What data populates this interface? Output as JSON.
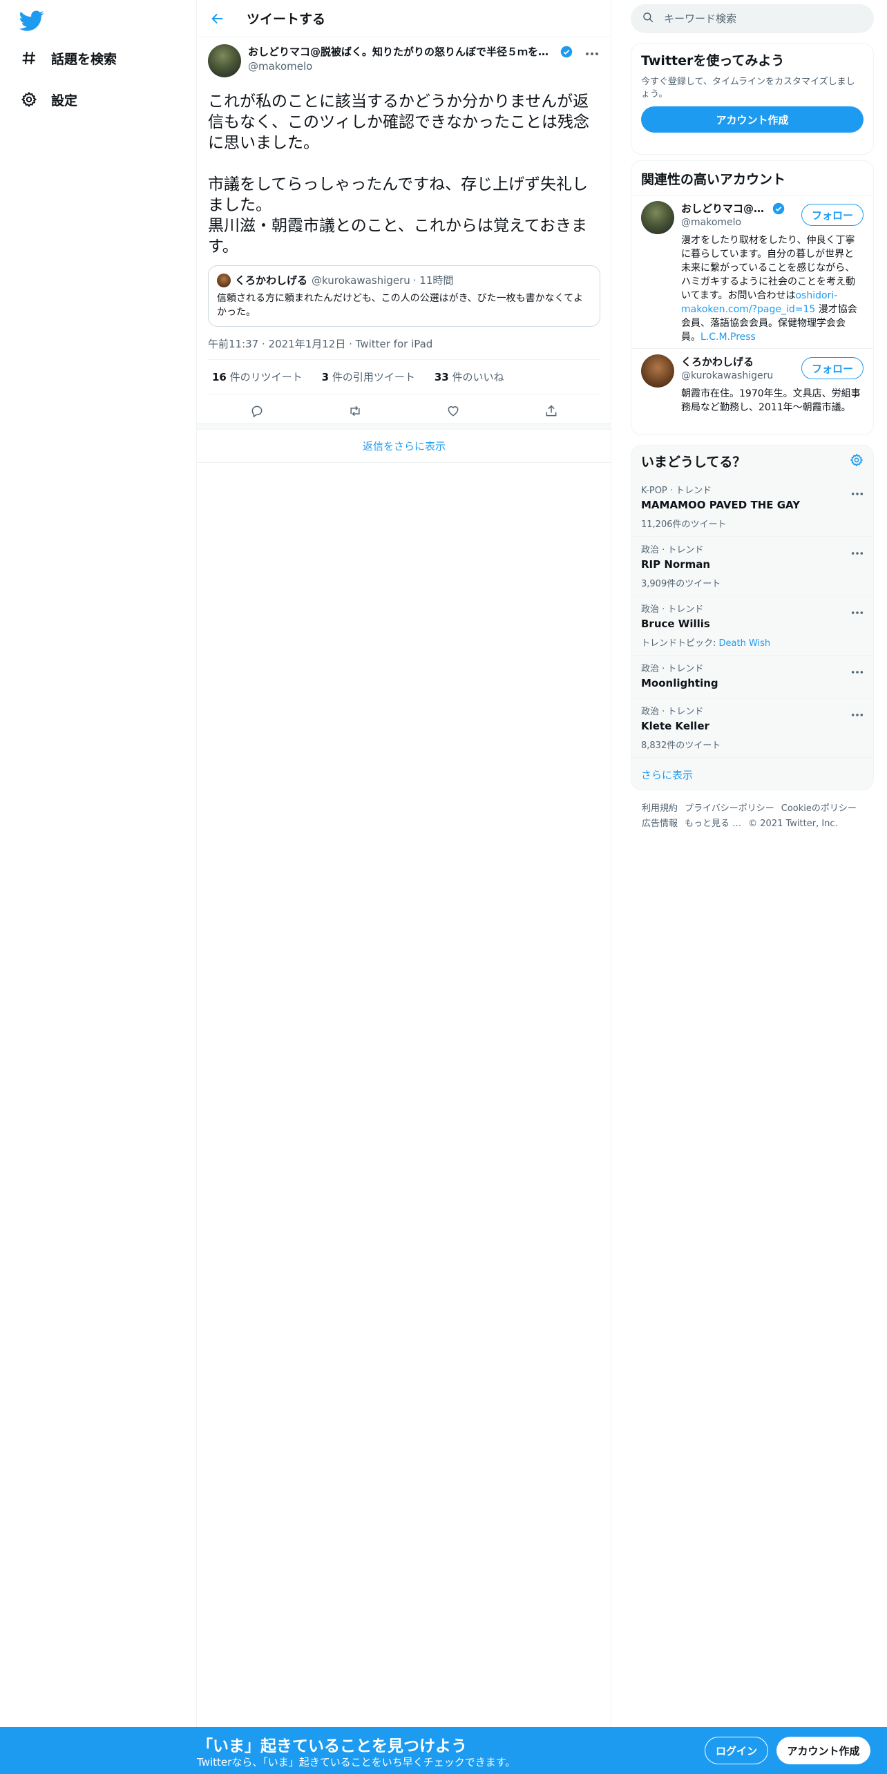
{
  "nav": {
    "logo": "twitter-bird-icon",
    "items": [
      {
        "label": "話題を検索",
        "icon": "hashtag-icon"
      },
      {
        "label": "設定",
        "icon": "gear-icon"
      }
    ]
  },
  "header": {
    "title": "ツイートする"
  },
  "tweet": {
    "author_name": "おしどりマコ@脱被ばく。知りたがりの怒りんぼで半径５ｍを変…",
    "author_handle": "@makomelo",
    "text": "これが私のことに該当するかどうか分かりませんが返信もなく、このツィしか確認できなかったことは残念に思いました。\n\n市議をしてらっしゃったんですね、存じ上げず失礼しました。\n黒川滋・朝霞市議とのこと、これからは覚えておきます。",
    "quote": {
      "name": "くろかわしげる",
      "handle": "@kurokawashigeru",
      "time": "· 11時間",
      "text": "信頼される方に頼まれたんだけども、この人の公選はがき、びた一枚も書かなくてよかった。"
    },
    "timestamp": "午前11:37 · 2021年1月12日 · Twitter for iPad",
    "stats": {
      "retweets_num": "16",
      "retweets_label": " 件のリツイート",
      "quotes_num": "3",
      "quotes_label": " 件の引用ツイート",
      "likes_num": "33",
      "likes_label": " 件のいいね"
    }
  },
  "replies": {
    "show_more": "返信をさらに表示"
  },
  "search": {
    "placeholder": "キーワード検索"
  },
  "signup_card": {
    "title": "Twitterを使ってみよう",
    "subtitle": "今すぐ登録して、タイムラインをカスタマイズしましょう。",
    "button": "アカウント作成"
  },
  "related": {
    "title": "関連性の高いアカウント",
    "accounts": [
      {
        "name": "おしどりマコ@脱…",
        "handle": "@makomelo",
        "follow": "フォロー",
        "bio": "漫才をしたり取材をしたり、仲良く丁寧に暮らしています。自分の暮しが世界と未来に繋がっていることを感じながら、ハミガキするように社会のことを考え動いてます。お問い合わせは",
        "bio_link": "oshidori-makoken.com/?page_id=15",
        "bio_rest": " 漫才協会会員、落語協会会員。保健物理学会会員。",
        "bio_link2": "L.C.M.Press"
      },
      {
        "name": "くろかわしげる",
        "handle": "@kurokawashigeru",
        "follow": "フォロー",
        "bio": "朝霞市在住。1970年生。文具店、労組事務局など勤務し、2011年～朝霞市議。"
      }
    ]
  },
  "trends": {
    "title": "いまどうしてる？",
    "items": [
      {
        "context": "K-POP · トレンド",
        "name": "MAMAMOO PAVED THE GAY",
        "count": "11,206件のツイート"
      },
      {
        "context": "政治 · トレンド",
        "name": "RIP Norman",
        "count": "3,909件のツイート"
      },
      {
        "context": "政治 · トレンド",
        "name": "Bruce Willis",
        "topic_label": "トレンドトピック: ",
        "topic_link": "Death Wish"
      },
      {
        "context": "政治 · トレンド",
        "name": "Moonlighting"
      },
      {
        "context": "政治 · トレンド",
        "name": "Klete Keller",
        "count": "8,832件のツイート"
      }
    ],
    "show_more": "さらに表示"
  },
  "footer": {
    "links": [
      "利用規約",
      "プライバシーポリシー",
      "Cookieのポリシー",
      "広告情報",
      "もっと見る …",
      "© 2021 Twitter, Inc."
    ]
  },
  "bottombar": {
    "title": "「いま」起きていることを見つけよう",
    "subtitle": "Twitterなら、「いま」起きていることをいち早くチェックできます。",
    "login": "ログイン",
    "signup": "アカウント作成"
  },
  "colors": {
    "accent": "#1d9bf0",
    "text": "#0f1419",
    "muted": "#536471",
    "border": "#eff3f4"
  }
}
